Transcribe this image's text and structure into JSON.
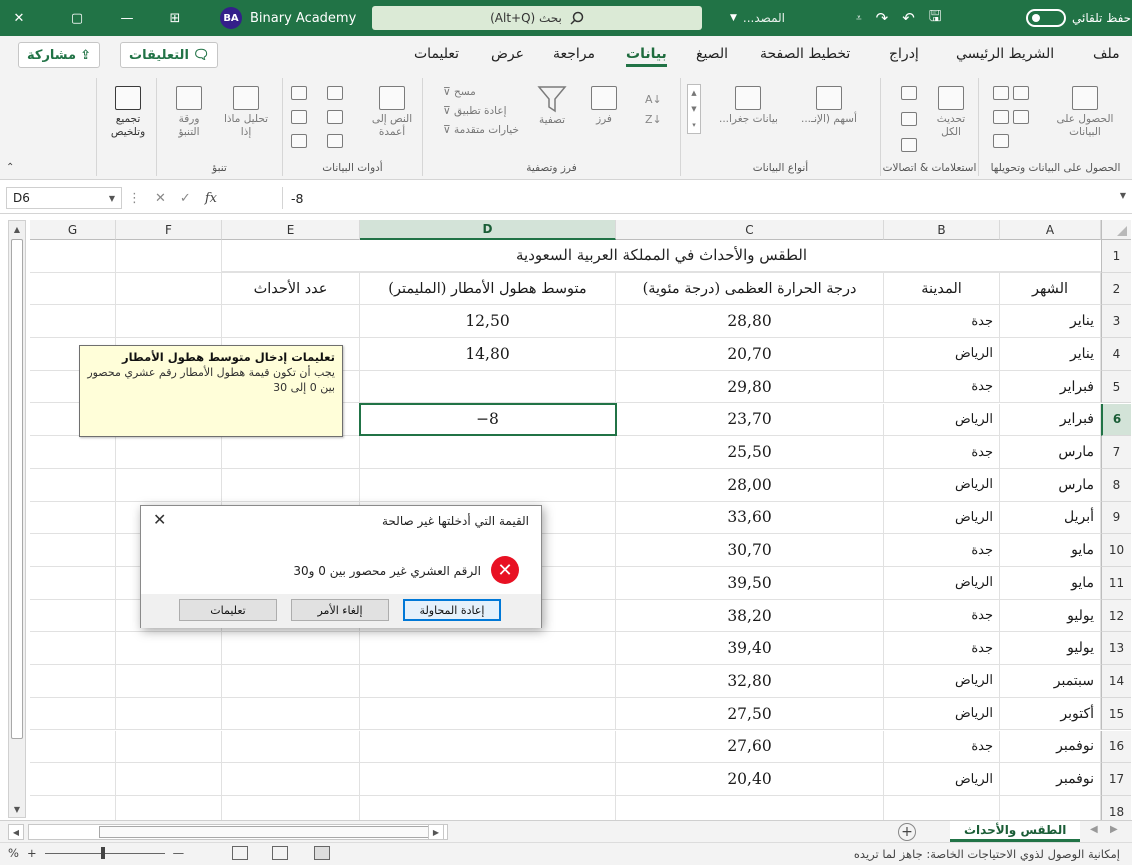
{
  "titlebar": {
    "autosave_label": "حفظ تلقائي",
    "file_name": "المصد...",
    "search_placeholder": "بحث (Alt+Q)",
    "account_name": "Binary Academy",
    "account_initials": "BA"
  },
  "menu": {
    "items": [
      "ملف",
      "الشريط الرئيسي",
      "إدراج",
      "تخطيط الصفحة",
      "الصيغ",
      "بيانات",
      "مراجعة",
      "عرض",
      "تعليمات"
    ],
    "active": "بيانات",
    "comments_label": "التعليقات",
    "share_label": "مشاركة"
  },
  "ribbon": {
    "groups": {
      "get_data": "الحصول على البيانات وتحويلها",
      "queries": "استعلامات & اتصالات",
      "data_types": "أنواع البيانات",
      "sort_filter": "فرز وتصفية",
      "data_tools": "أدوات البيانات",
      "forecast": "تنبؤ",
      "outline": ""
    },
    "buttons": {
      "get_data": "الحصول على البيانات",
      "refresh_all": "تحديث الكل",
      "stocks": "أسهم (الإنـ...",
      "geography": "بيانات جغرا...",
      "sort": "فرز",
      "filter": "تصفية",
      "clear": "مسح",
      "reapply": "إعادة تطبيق",
      "advanced": "خيارات متقدمة",
      "text_to_columns": "النص إلى أعمدة",
      "what_if": "تحليل ماذا إذا",
      "forecast_sheet": "ورقة التنبؤ",
      "outline": "تجميع وتلخيص"
    }
  },
  "formula_bar": {
    "name_box": "D6",
    "formula": "-8"
  },
  "grid": {
    "columns": [
      "A",
      "B",
      "C",
      "D",
      "E",
      "F",
      "G"
    ],
    "rows": [
      "1",
      "2",
      "3",
      "4",
      "5",
      "6",
      "7",
      "8",
      "9",
      "10",
      "11",
      "12",
      "13",
      "14",
      "15",
      "16",
      "17",
      "18"
    ],
    "selected_column": "D",
    "selected_row": "6",
    "title": "الطقس والأحداث في المملكة العربية السعودية",
    "headers": {
      "month": "الشهر",
      "city": "المدينة",
      "max_temp": "درجة الحرارة العظمى (درجة مئوية)",
      "avg_rain": "متوسط هطول الأمطار (المليمتر)",
      "events": "عدد الأحداث"
    },
    "data_rows": [
      {
        "month": "يناير",
        "city": "جدة",
        "temp": "28,80",
        "rain": "12,50",
        "events": ""
      },
      {
        "month": "يناير",
        "city": "الرياض",
        "temp": "20,70",
        "rain": "14,80",
        "events": ""
      },
      {
        "month": "فبراير",
        "city": "جدة",
        "temp": "29,80",
        "rain": "",
        "events": ""
      },
      {
        "month": "فبراير",
        "city": "الرياض",
        "temp": "23,70",
        "rain": "−8",
        "events": ""
      },
      {
        "month": "مارس",
        "city": "جدة",
        "temp": "25,50",
        "rain": "",
        "events": ""
      },
      {
        "month": "مارس",
        "city": "الرياض",
        "temp": "28,00",
        "rain": "",
        "events": ""
      },
      {
        "month": "أبريل",
        "city": "الرياض",
        "temp": "33,60",
        "rain": "",
        "events": ""
      },
      {
        "month": "مايو",
        "city": "جدة",
        "temp": "30,70",
        "rain": "",
        "events": ""
      },
      {
        "month": "مايو",
        "city": "الرياض",
        "temp": "39,50",
        "rain": "",
        "events": ""
      },
      {
        "month": "يوليو",
        "city": "جدة",
        "temp": "38,20",
        "rain": "",
        "events": ""
      },
      {
        "month": "يوليو",
        "city": "جدة",
        "temp": "39,40",
        "rain": "",
        "events": ""
      },
      {
        "month": "سبتمبر",
        "city": "الرياض",
        "temp": "32,80",
        "rain": "",
        "events": ""
      },
      {
        "month": "أكتوبر",
        "city": "الرياض",
        "temp": "27,50",
        "rain": "",
        "events": ""
      },
      {
        "month": "نوفمبر",
        "city": "جدة",
        "temp": "27,60",
        "rain": "",
        "events": ""
      },
      {
        "month": "نوفمبر",
        "city": "الرياض",
        "temp": "20,40",
        "rain": "",
        "events": ""
      }
    ]
  },
  "input_message": {
    "title": "تعليمات إدخال متوسط هطول الأمطار",
    "body": "يجب أن تكون قيمة هطول الأمطار رقم عشري محصور بين 0 إلى 30"
  },
  "error_dialog": {
    "title": "القيمة التي أدخلتها غير صالحة",
    "message": "الرقم العشري غير محصور بين 0 و30",
    "retry_label": "إعادة المحاولة",
    "cancel_label": "إلغاء الأمر",
    "help_label": "تعليمات"
  },
  "sheets": {
    "active": "الطقس والأحداث"
  },
  "statusbar": {
    "text": "إمكانية الوصول لذوي الاحتياجات الخاصة: جاهز لما تريده",
    "zoom": "%"
  },
  "colors": {
    "brand": "#217346",
    "error": "#e81123",
    "focus": "#0078d7"
  },
  "icons": {
    "search": "search-icon",
    "undo": "undo-icon",
    "redo": "redo-icon",
    "save": "save-icon",
    "close": "close-icon",
    "error": "error-icon",
    "comment": "comment-icon",
    "share": "share-icon",
    "fx": "function-icon"
  }
}
